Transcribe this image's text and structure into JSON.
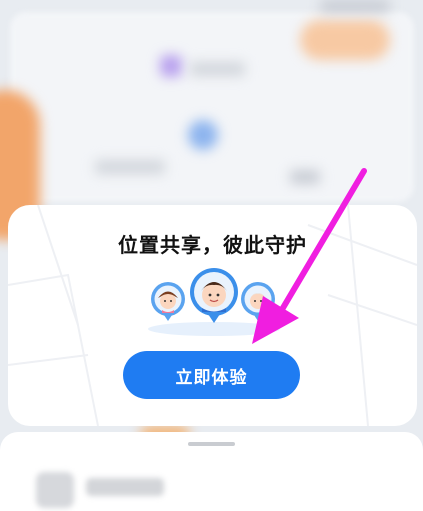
{
  "modal": {
    "title": "位置共享，彼此守护",
    "cta_label": "立即体验"
  },
  "colors": {
    "cta_background": "#1f7cf2",
    "annotation_arrow": "#f01ee0",
    "map_orange": "#f2a56a",
    "map_purple": "#b9a2ee"
  },
  "icons": {
    "illustration": "family-location-pins-illustration",
    "arrow": "pointer-arrow-annotation"
  }
}
